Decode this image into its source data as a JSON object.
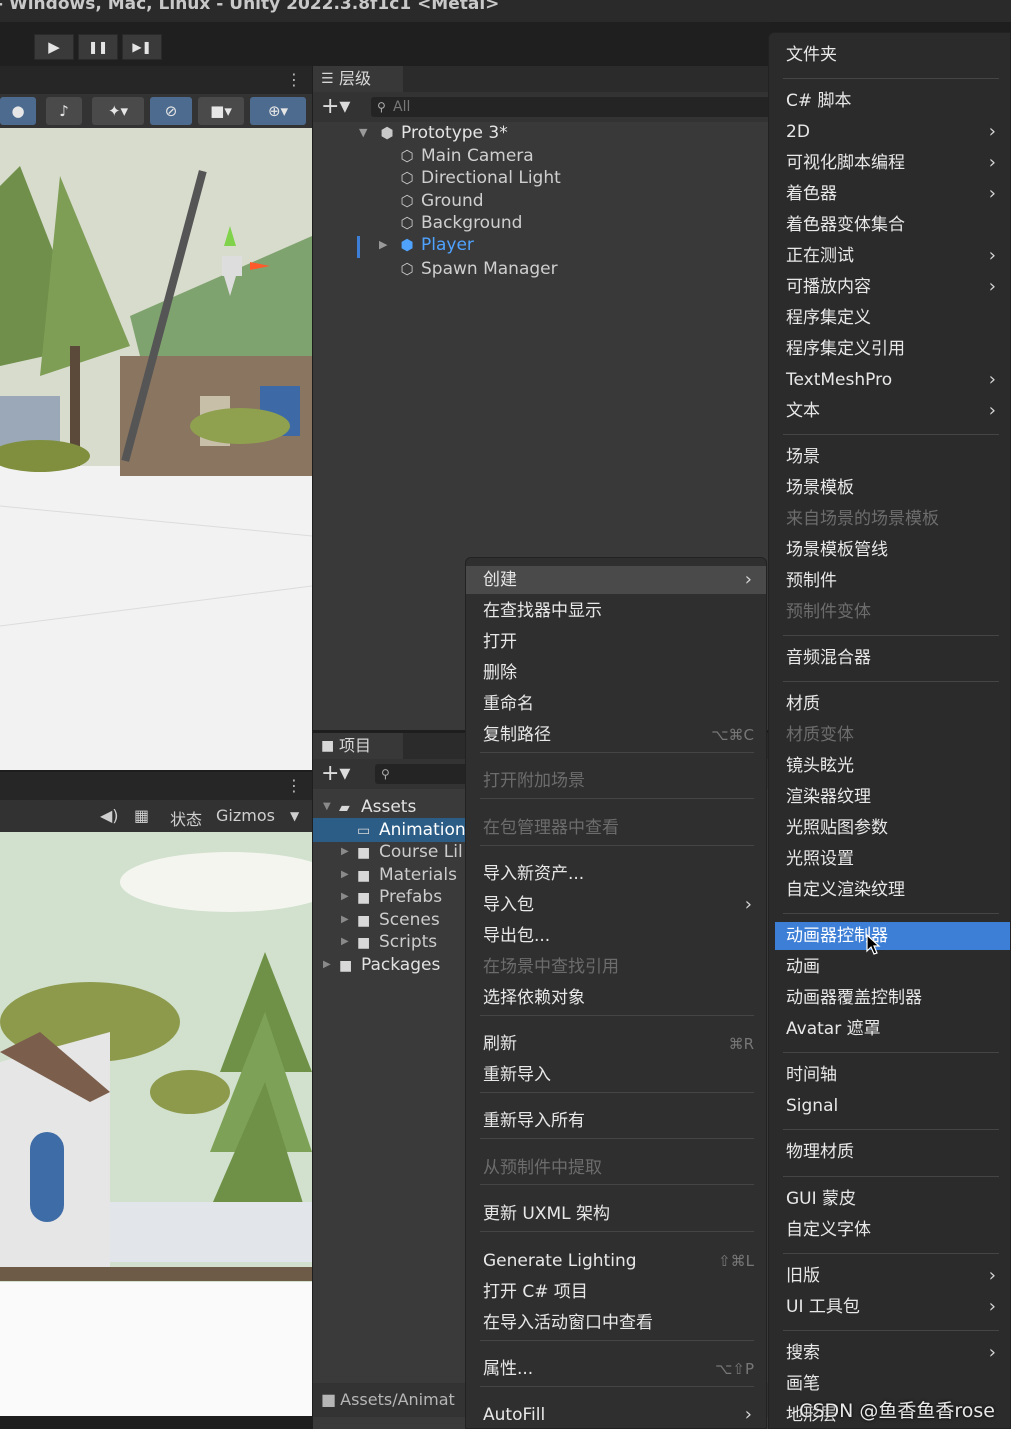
{
  "window": {
    "title": "- Windows, Mac, Linux - Unity 2022.3.8f1c1 <Metal>"
  },
  "playbar": {
    "play": "▶",
    "pause": "❚❚",
    "step": "▶❚"
  },
  "scene_view": {
    "more": "⋮"
  },
  "game_view": {
    "more": "⋮",
    "status_label": "状态",
    "gizmos_label": "Gizmos"
  },
  "hierarchy": {
    "tab": "层级",
    "search_placeholder": "All",
    "scene_name": "Prototype 3*",
    "items": [
      "Main Camera",
      "Directional Light",
      "Ground",
      "Background",
      "Player",
      "Spawn Manager"
    ],
    "selected_color": "#4fa3ff"
  },
  "project": {
    "tab": "项目",
    "root": "Assets",
    "folders": [
      "Animation",
      "Course Lil",
      "Materials",
      "Prefabs",
      "Scenes",
      "Scripts"
    ],
    "packages": "Packages",
    "footer_path": "Assets/Animat"
  },
  "context_menu": {
    "items": [
      {
        "label": "创建",
        "submenu": true,
        "highlighted": true
      },
      {
        "label": "在查找器中显示"
      },
      {
        "label": "打开"
      },
      {
        "label": "删除"
      },
      {
        "label": "重命名"
      },
      {
        "label": "复制路径",
        "shortcut": "⌥⌘C"
      },
      {
        "label": "打开附加场景",
        "disabled": true
      },
      {
        "label": "在包管理器中查看",
        "disabled": true
      },
      {
        "label": "导入新资产..."
      },
      {
        "label": "导入包",
        "submenu": true
      },
      {
        "label": "导出包..."
      },
      {
        "label": "在场景中查找引用",
        "disabled": true
      },
      {
        "label": "选择依赖对象"
      },
      {
        "label": "刷新",
        "shortcut": "⌘R"
      },
      {
        "label": "重新导入"
      },
      {
        "label": "重新导入所有"
      },
      {
        "label": "从预制件中提取",
        "disabled": true
      },
      {
        "label": "更新 UXML 架构"
      },
      {
        "label": "Generate Lighting",
        "shortcut": "⇧⌘L"
      },
      {
        "label": "打开 C# 项目"
      },
      {
        "label": "在导入活动窗口中查看"
      },
      {
        "label": "属性...",
        "shortcut": "⌥⇧P"
      },
      {
        "label": "AutoFill",
        "submenu": true
      }
    ]
  },
  "create_submenu": {
    "items": [
      {
        "label": "文件夹"
      },
      {
        "label": "C# 脚本"
      },
      {
        "label": "2D",
        "submenu": true
      },
      {
        "label": "可视化脚本编程",
        "submenu": true
      },
      {
        "label": "着色器",
        "submenu": true
      },
      {
        "label": "着色器变体集合"
      },
      {
        "label": "正在测试",
        "submenu": true
      },
      {
        "label": "可播放内容",
        "submenu": true
      },
      {
        "label": "程序集定义"
      },
      {
        "label": "程序集定义引用"
      },
      {
        "label": "TextMeshPro",
        "submenu": true
      },
      {
        "label": "文本",
        "submenu": true
      },
      {
        "label": "场景"
      },
      {
        "label": "场景模板"
      },
      {
        "label": "来自场景的场景模板",
        "disabled": true
      },
      {
        "label": "场景模板管线"
      },
      {
        "label": "预制件"
      },
      {
        "label": "预制件变体",
        "disabled": true
      },
      {
        "label": "音频混合器"
      },
      {
        "label": "材质"
      },
      {
        "label": "材质变体",
        "disabled": true
      },
      {
        "label": "镜头眩光"
      },
      {
        "label": "渲染器纹理"
      },
      {
        "label": "光照贴图参数"
      },
      {
        "label": "光照设置"
      },
      {
        "label": "自定义渲染纹理"
      },
      {
        "label": "动画器控制器",
        "selected": true
      },
      {
        "label": "动画"
      },
      {
        "label": "动画器覆盖控制器"
      },
      {
        "label": "Avatar 遮罩"
      },
      {
        "label": "时间轴"
      },
      {
        "label": "Signal"
      },
      {
        "label": "物理材质"
      },
      {
        "label": "GUI 蒙皮"
      },
      {
        "label": "自定义字体"
      },
      {
        "label": "旧版",
        "submenu": true
      },
      {
        "label": "UI 工具包",
        "submenu": true
      },
      {
        "label": "搜索",
        "submenu": true
      },
      {
        "label": "画笔"
      },
      {
        "label": "地形层"
      }
    ],
    "selected_color": "#3d7fd6"
  },
  "watermark": "CSDN @鱼香鱼香rose"
}
